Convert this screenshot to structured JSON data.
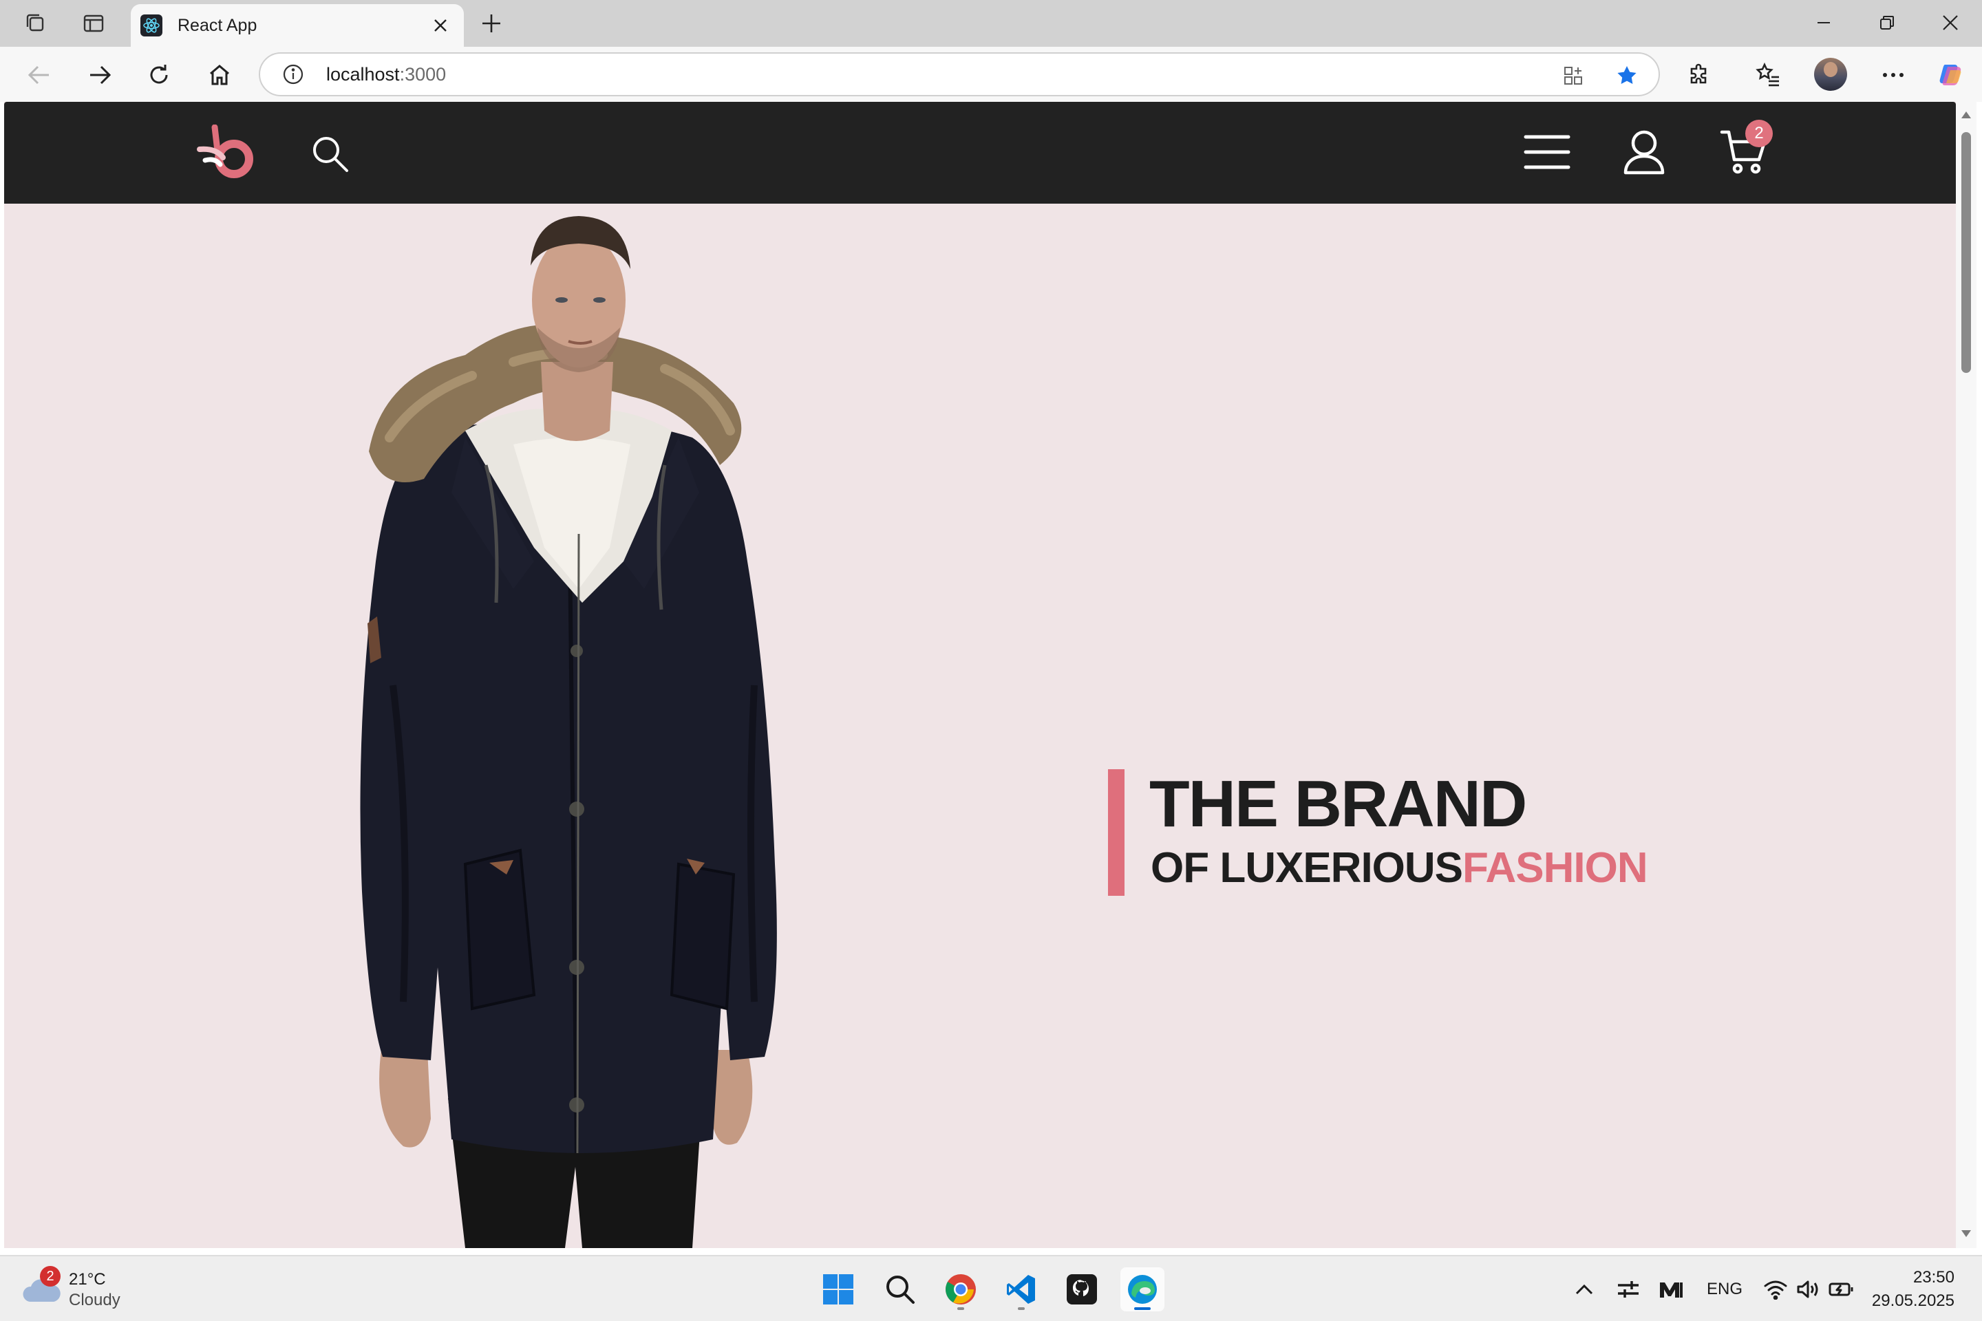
{
  "browser": {
    "tab_title": "React App",
    "url_host": "localhost",
    "url_port": ":3000"
  },
  "site": {
    "cart_count": "2",
    "hero": {
      "headline_line1": "THE BRAND",
      "headline_line2_prefix": "OF LUXERIOUS",
      "headline_line2_accent": "FASHION"
    },
    "colors": {
      "accent": "#df6f7c",
      "navbar": "#222222",
      "hero_bg": "#f0e4e6"
    }
  },
  "taskbar": {
    "weather_badge": "2",
    "weather_temp": "21°C",
    "weather_desc": "Cloudy",
    "language": "ENG",
    "time": "23:50",
    "date": "29.05.2025"
  }
}
